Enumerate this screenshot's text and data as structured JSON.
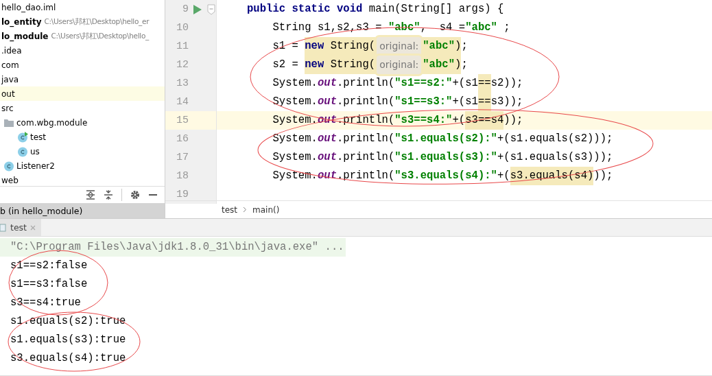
{
  "project_tree": {
    "items": [
      {
        "label": "hello_dao.iml",
        "bold": false,
        "selected": false
      },
      {
        "label": "lo_entity",
        "bold": true,
        "path": "C:\\Users\\邦杠\\Desktop\\hello_er",
        "selected": false
      },
      {
        "label": "lo_module",
        "bold": true,
        "path": "C:\\Users\\邦杠\\Desktop\\hello_",
        "selected": false
      },
      {
        "label": ".idea",
        "bold": false,
        "selected": false
      },
      {
        "label": "com",
        "bold": false,
        "selected": false
      },
      {
        "label": "java",
        "bold": false,
        "selected": false
      },
      {
        "label": "out",
        "bold": false,
        "selected": true
      },
      {
        "label": "src",
        "bold": false,
        "selected": false,
        "children": [
          {
            "label": "com.wbg.module",
            "bold": false,
            "kind": "package",
            "selected": false,
            "children": [
              {
                "label": "test",
                "bold": false,
                "kind": "runnable-class",
                "selected": false
              },
              {
                "label": "us",
                "bold": false,
                "kind": "class",
                "selected": false
              }
            ]
          },
          {
            "label": "Listener2",
            "bold": false,
            "kind": "class",
            "selected": false
          }
        ]
      },
      {
        "label": "web",
        "bold": false,
        "selected": false
      }
    ]
  },
  "run_config_label": "b (in hello_module)",
  "editor": {
    "lines": [
      {
        "number": "9",
        "current": false,
        "kind": "method-start",
        "tokens": [
          {
            "text": "public static void",
            "kind": "keyword",
            "highlight": false
          },
          {
            "text": " main(String[] args) {",
            "kind": "plain",
            "highlight": false
          }
        ]
      },
      {
        "number": "10",
        "current": false,
        "kind": "plain",
        "tokens": [
          {
            "text": "    String s1,s2,s3 = ",
            "kind": "plain",
            "highlight": false
          },
          {
            "text": "\"abc\"",
            "kind": "string",
            "highlight": false
          },
          {
            "text": ",  s4 =",
            "kind": "plain",
            "highlight": false
          },
          {
            "text": "\"abc\"",
            "kind": "string",
            "highlight": false
          },
          {
            "text": " ;",
            "kind": "plain",
            "highlight": false
          }
        ]
      },
      {
        "number": "11",
        "current": false,
        "kind": "plain",
        "tokens": [
          {
            "text": "    s1 = ",
            "kind": "plain",
            "highlight": false
          },
          {
            "text": "new",
            "kind": "keyword",
            "highlight": true
          },
          {
            "text": " String(",
            "kind": "plain",
            "highlight": true
          },
          {
            "text": "original:",
            "kind": "hint",
            "highlight": true
          },
          {
            "text": "\"abc\"",
            "kind": "string",
            "highlight": true
          },
          {
            "text": ")",
            "kind": "plain",
            "highlight": true
          },
          {
            "text": ";",
            "kind": "plain",
            "highlight": false
          }
        ]
      },
      {
        "number": "12",
        "current": false,
        "kind": "plain",
        "tokens": [
          {
            "text": "    s2 = ",
            "kind": "plain",
            "highlight": false
          },
          {
            "text": "new",
            "kind": "keyword",
            "highlight": true
          },
          {
            "text": " String(",
            "kind": "plain",
            "highlight": true
          },
          {
            "text": "original:",
            "kind": "hint",
            "highlight": true
          },
          {
            "text": "\"abc\"",
            "kind": "string",
            "highlight": true
          },
          {
            "text": ")",
            "kind": "plain",
            "highlight": true
          },
          {
            "text": ";",
            "kind": "plain",
            "highlight": false
          }
        ]
      },
      {
        "number": "13",
        "current": false,
        "kind": "plain",
        "tokens": [
          {
            "text": "    System.",
            "kind": "plain",
            "highlight": false
          },
          {
            "text": "out",
            "kind": "field",
            "highlight": false
          },
          {
            "text": ".println(",
            "kind": "plain",
            "highlight": false
          },
          {
            "text": "\"s1==s2:\"",
            "kind": "string",
            "highlight": false
          },
          {
            "text": "+(s1",
            "kind": "plain",
            "highlight": false
          },
          {
            "text": "==",
            "kind": "plain",
            "highlight": true
          },
          {
            "text": "s2));",
            "kind": "plain",
            "highlight": false
          }
        ]
      },
      {
        "number": "14",
        "current": false,
        "kind": "plain",
        "tokens": [
          {
            "text": "    System.",
            "kind": "plain",
            "highlight": false
          },
          {
            "text": "out",
            "kind": "field",
            "highlight": false
          },
          {
            "text": ".println(",
            "kind": "plain",
            "highlight": false
          },
          {
            "text": "\"s1==s3:\"",
            "kind": "string",
            "highlight": false
          },
          {
            "text": "+(s1",
            "kind": "plain",
            "highlight": false
          },
          {
            "text": "==",
            "kind": "plain",
            "highlight": true
          },
          {
            "text": "s3));",
            "kind": "plain",
            "highlight": false
          }
        ]
      },
      {
        "number": "15",
        "current": true,
        "kind": "plain",
        "tokens": [
          {
            "text": "    System.",
            "kind": "plain",
            "highlight": false
          },
          {
            "text": "out",
            "kind": "field",
            "highlight": false
          },
          {
            "text": ".println(",
            "kind": "plain",
            "highlight": false
          },
          {
            "text": "\"s3==s4:\"",
            "kind": "string",
            "highlight": false
          },
          {
            "text": "+(",
            "kind": "plain",
            "highlight": false
          },
          {
            "text": "s3==s4",
            "kind": "plain",
            "highlight": true
          },
          {
            "text": "));",
            "kind": "plain",
            "highlight": false
          }
        ]
      },
      {
        "number": "16",
        "current": false,
        "kind": "plain",
        "tokens": [
          {
            "text": "    System.",
            "kind": "plain",
            "highlight": false
          },
          {
            "text": "out",
            "kind": "field",
            "highlight": false
          },
          {
            "text": ".println(",
            "kind": "plain",
            "highlight": false
          },
          {
            "text": "\"s1.equals(s2):\"",
            "kind": "string",
            "highlight": false
          },
          {
            "text": "+(s1.equals(s2)));",
            "kind": "plain",
            "highlight": false
          }
        ]
      },
      {
        "number": "17",
        "current": false,
        "kind": "plain",
        "tokens": [
          {
            "text": "    System.",
            "kind": "plain",
            "highlight": false
          },
          {
            "text": "out",
            "kind": "field",
            "highlight": false
          },
          {
            "text": ".println(",
            "kind": "plain",
            "highlight": false
          },
          {
            "text": "\"s1.equals(s3):\"",
            "kind": "string",
            "highlight": false
          },
          {
            "text": "+(s1.equals(s3)));",
            "kind": "plain",
            "highlight": false
          }
        ]
      },
      {
        "number": "18",
        "current": false,
        "kind": "plain",
        "tokens": [
          {
            "text": "    System.",
            "kind": "plain",
            "highlight": false
          },
          {
            "text": "out",
            "kind": "field",
            "highlight": false
          },
          {
            "text": ".println(",
            "kind": "plain",
            "highlight": false
          },
          {
            "text": "\"s3.equals(s4):\"",
            "kind": "string",
            "highlight": false
          },
          {
            "text": "+(",
            "kind": "plain",
            "highlight": false
          },
          {
            "text": "s3.equals(s4)",
            "kind": "plain",
            "highlight": true
          },
          {
            "text": "));",
            "kind": "plain",
            "highlight": false
          }
        ]
      },
      {
        "number": "19",
        "current": false,
        "kind": "plain"
      }
    ]
  },
  "breadcrumbs": [
    "test",
    "main()"
  ],
  "run_tab": {
    "label": "test",
    "selected": true
  },
  "console": {
    "lines": [
      {
        "text": "\"C:\\Program Files\\Java\\jdk1.8.0_31\\bin\\java.exe\" ...",
        "kind": "command"
      },
      {
        "text": "s1==s2:false",
        "kind": "output"
      },
      {
        "text": "s1==s3:false",
        "kind": "output"
      },
      {
        "text": "s3==s4:true",
        "kind": "output"
      },
      {
        "text": "s1.equals(s2):true",
        "kind": "output"
      },
      {
        "text": "s1.equals(s3):true",
        "kind": "output"
      },
      {
        "text": "s3.equals(s4):true",
        "kind": "output"
      }
    ]
  }
}
